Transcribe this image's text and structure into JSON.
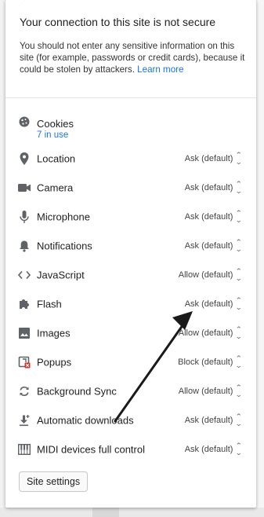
{
  "popup": {
    "title": "Your connection to this site is not secure",
    "description": "You should not enter any sensitive information on this site (for example, passwords or credit cards), because it could be stolen by attackers.",
    "learn_more": "Learn more"
  },
  "cookies": {
    "label": "Cookies",
    "count": "7 in use",
    "icon": "cookie-icon"
  },
  "permissions": [
    {
      "label": "Location",
      "value": "Ask (default)",
      "icon": "location-pin-icon"
    },
    {
      "label": "Camera",
      "value": "Ask (default)",
      "icon": "camera-icon"
    },
    {
      "label": "Microphone",
      "value": "Ask (default)",
      "icon": "microphone-icon"
    },
    {
      "label": "Notifications",
      "value": "Ask (default)",
      "icon": "bell-icon"
    },
    {
      "label": "JavaScript",
      "value": "Allow (default)",
      "icon": "code-brackets-icon"
    },
    {
      "label": "Flash",
      "value": "Ask (default)",
      "icon": "puzzle-piece-icon"
    },
    {
      "label": "Images",
      "value": "Allow (default)",
      "icon": "image-icon"
    },
    {
      "label": "Popups",
      "value": "Block (default)",
      "icon": "popup-blocked-icon"
    },
    {
      "label": "Background Sync",
      "value": "Allow (default)",
      "icon": "sync-icon"
    },
    {
      "label": "Automatic downloads",
      "value": "Ask (default)",
      "icon": "download-icon"
    },
    {
      "label": "MIDI devices full control",
      "value": "Ask (default)",
      "icon": "piano-keys-icon"
    }
  ],
  "site_settings_button": "Site settings",
  "colors": {
    "link": "#1a73e8",
    "popup_bg": "#ffffff",
    "arrow": "#1a1a1a",
    "popup_blocked_badge": "#d93025"
  }
}
